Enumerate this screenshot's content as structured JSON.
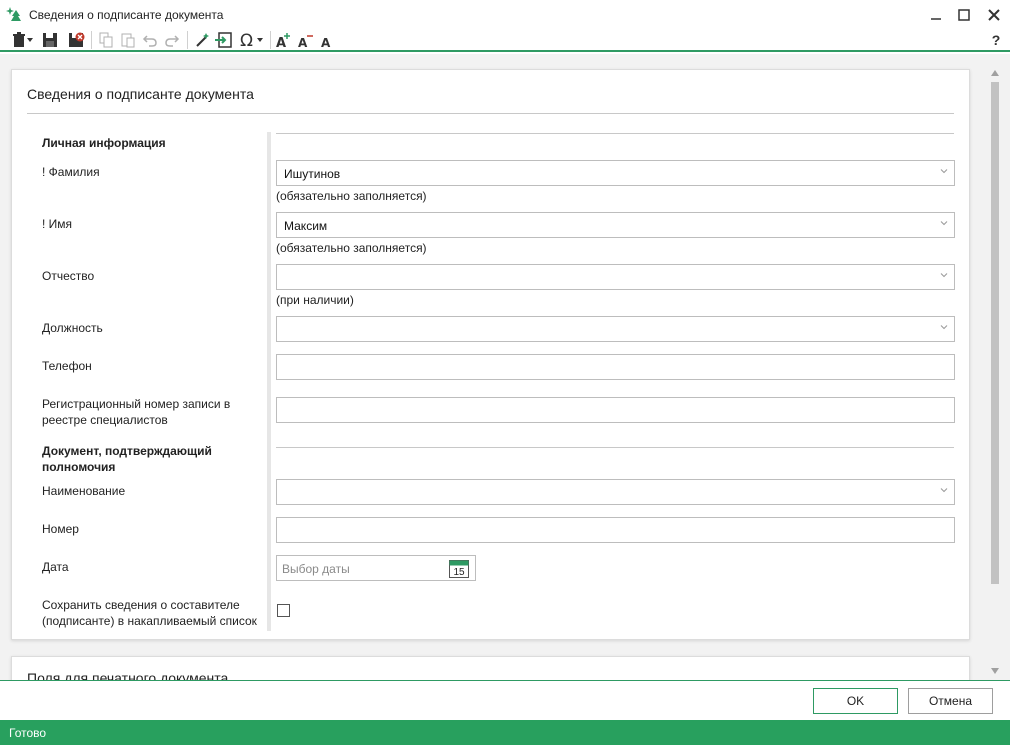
{
  "window": {
    "title": "Сведения о подписанте документа",
    "help_label": "?"
  },
  "colors": {
    "accent": "#2e9a63",
    "status_bar": "#28a05e"
  },
  "card": {
    "title": "Сведения о подписанте документа",
    "next_card_title": "Поля для печатного документа"
  },
  "personal": {
    "section_title": "Личная информация",
    "last_name": {
      "label": "! Фамилия",
      "value": "Ишутинов",
      "hint": "(обязательно заполняется)"
    },
    "first_name": {
      "label": "! Имя",
      "value": "Максим",
      "hint": "(обязательно заполняется)"
    },
    "patronymic": {
      "label": "Отчество",
      "value": "",
      "hint": "(при наличии)"
    },
    "position": {
      "label": "Должность",
      "value": ""
    },
    "phone": {
      "label": "Телефон",
      "value": ""
    },
    "reg_number": {
      "label_line1": "Регистрационный номер записи в",
      "label_line2": "реестре специалистов",
      "value": ""
    }
  },
  "authority": {
    "section_title_line1": "Документ, подтверждающий",
    "section_title_line2": "полномочия",
    "name": {
      "label": "Наименование",
      "value": ""
    },
    "number": {
      "label": "Номер",
      "value": ""
    },
    "date": {
      "label": "Дата",
      "placeholder": "Выбор даты",
      "calendar_day": "15"
    }
  },
  "save_option": {
    "label_line1": "Сохранить сведения о составителе",
    "label_line2": "(подписанте) в накапливаемый список",
    "checked": false
  },
  "footer": {
    "ok_label": "OK",
    "cancel_label": "Отмена"
  },
  "status": {
    "text": "Готово"
  }
}
